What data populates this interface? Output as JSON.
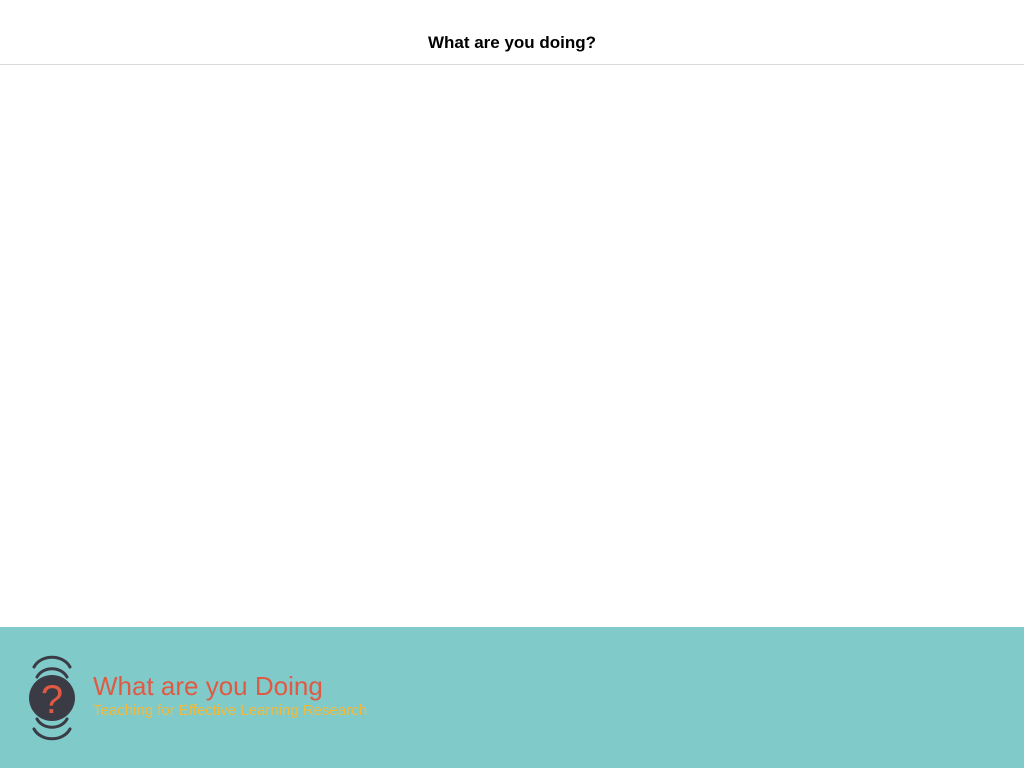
{
  "navbar": {
    "title": "What are you doing?"
  },
  "footer": {
    "logo_icon": "question-mark-logo-icon",
    "logo_glyph": "?",
    "brand_title": "What are you Doing",
    "brand_subtitle": "Teaching for Effective Learning Research"
  },
  "colors": {
    "footer_background": "#80cac9",
    "brand_title": "#e05a43",
    "brand_subtitle": "#f3b938",
    "logo_dark": "#3a3b45",
    "divider": "#d9d9d9"
  }
}
